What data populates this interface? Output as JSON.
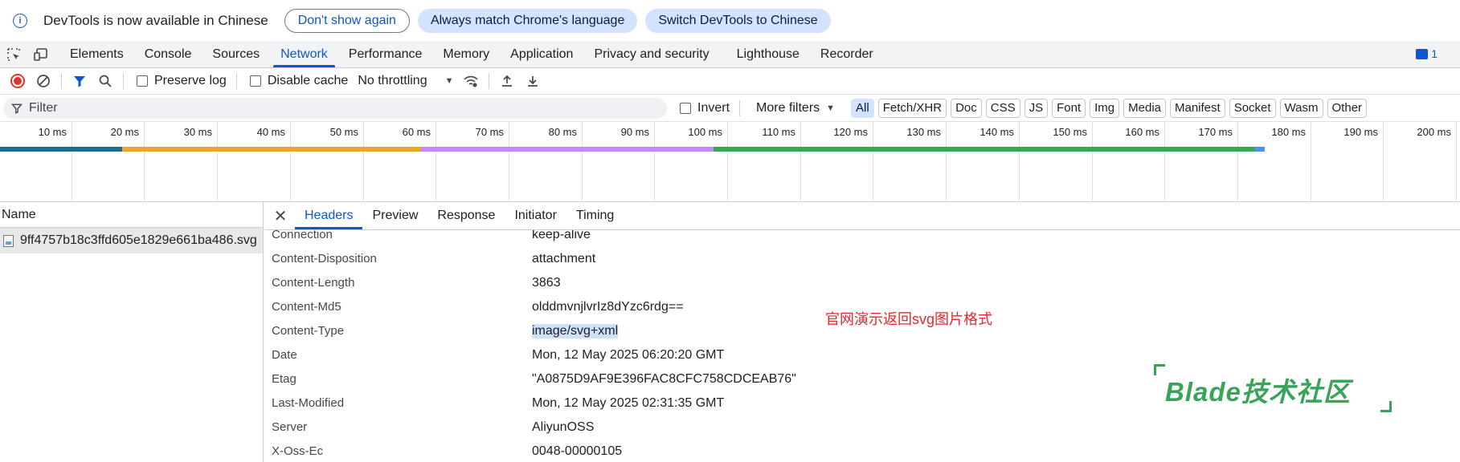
{
  "infobar": {
    "icon": "info-icon",
    "message": "DevTools is now available in Chinese",
    "dont_show_again": "Don't show again",
    "always_match": "Always match Chrome's language",
    "switch_chinese": "Switch DevTools to Chinese"
  },
  "tabs": [
    "Elements",
    "Console",
    "Sources",
    "Network",
    "Performance",
    "Memory",
    "Application",
    "Privacy and security",
    "Lighthouse",
    "Recorder"
  ],
  "active_tab": "Network",
  "issues_count": "1",
  "toolbar": {
    "preserve_log": "Preserve log",
    "disable_cache": "Disable cache",
    "throttling": "No throttling"
  },
  "filter": {
    "placeholder": "Filter",
    "invert": "Invert",
    "more_filters": "More filters",
    "types": [
      "All",
      "Fetch/XHR",
      "Doc",
      "CSS",
      "JS",
      "Font",
      "Img",
      "Media",
      "Manifest",
      "Socket",
      "Wasm",
      "Other"
    ],
    "active_type": "All"
  },
  "timeline": {
    "ticks": [
      "10 ms",
      "20 ms",
      "30 ms",
      "40 ms",
      "50 ms",
      "60 ms",
      "70 ms",
      "80 ms",
      "90 ms",
      "100 ms",
      "110 ms",
      "120 ms",
      "130 ms",
      "140 ms",
      "150 ms",
      "160 ms",
      "170 ms",
      "180 ms",
      "190 ms",
      "200 ms"
    ],
    "segments": [
      {
        "start_ms": 0,
        "end_ms": 16.8,
        "color": "#1e6b8f"
      },
      {
        "start_ms": 16.8,
        "end_ms": 57.8,
        "color": "#e8a72a"
      },
      {
        "start_ms": 57.8,
        "end_ms": 97.9,
        "color": "#c58af9"
      },
      {
        "start_ms": 97.9,
        "end_ms": 172.2,
        "color": "#34a853"
      },
      {
        "start_ms": 172.2,
        "end_ms": 173.5,
        "color": "#4f8ff7"
      }
    ]
  },
  "requests": {
    "name_header": "Name",
    "items": [
      "9ff4757b18c3ffd605e1829e661ba486.svg"
    ]
  },
  "detail_tabs": [
    "Headers",
    "Preview",
    "Response",
    "Initiator",
    "Timing"
  ],
  "active_detail_tab": "Headers",
  "headers": [
    {
      "key": "Connection",
      "value": "keep-alive"
    },
    {
      "key": "Content-Disposition",
      "value": "attachment"
    },
    {
      "key": "Content-Length",
      "value": "3863"
    },
    {
      "key": "Content-Md5",
      "value": "olddmvnjlvrIz8dYzc6rdg=="
    },
    {
      "key": "Content-Type",
      "value": "image/svg+xml",
      "selected": true
    },
    {
      "key": "Date",
      "value": "Mon, 12 May 2025 06:20:20 GMT"
    },
    {
      "key": "Etag",
      "value": "\"A0875D9AF9E396FAC8CFC758CDCEAB76\""
    },
    {
      "key": "Last-Modified",
      "value": "Mon, 12 May 2025 02:31:35 GMT"
    },
    {
      "key": "Server",
      "value": "AliyunOSS"
    },
    {
      "key": "X-Oss-Ec",
      "value": "0048-00000105"
    }
  ],
  "annotation": "官网演示返回svg图片格式",
  "watermark": "Blade技术社区"
}
